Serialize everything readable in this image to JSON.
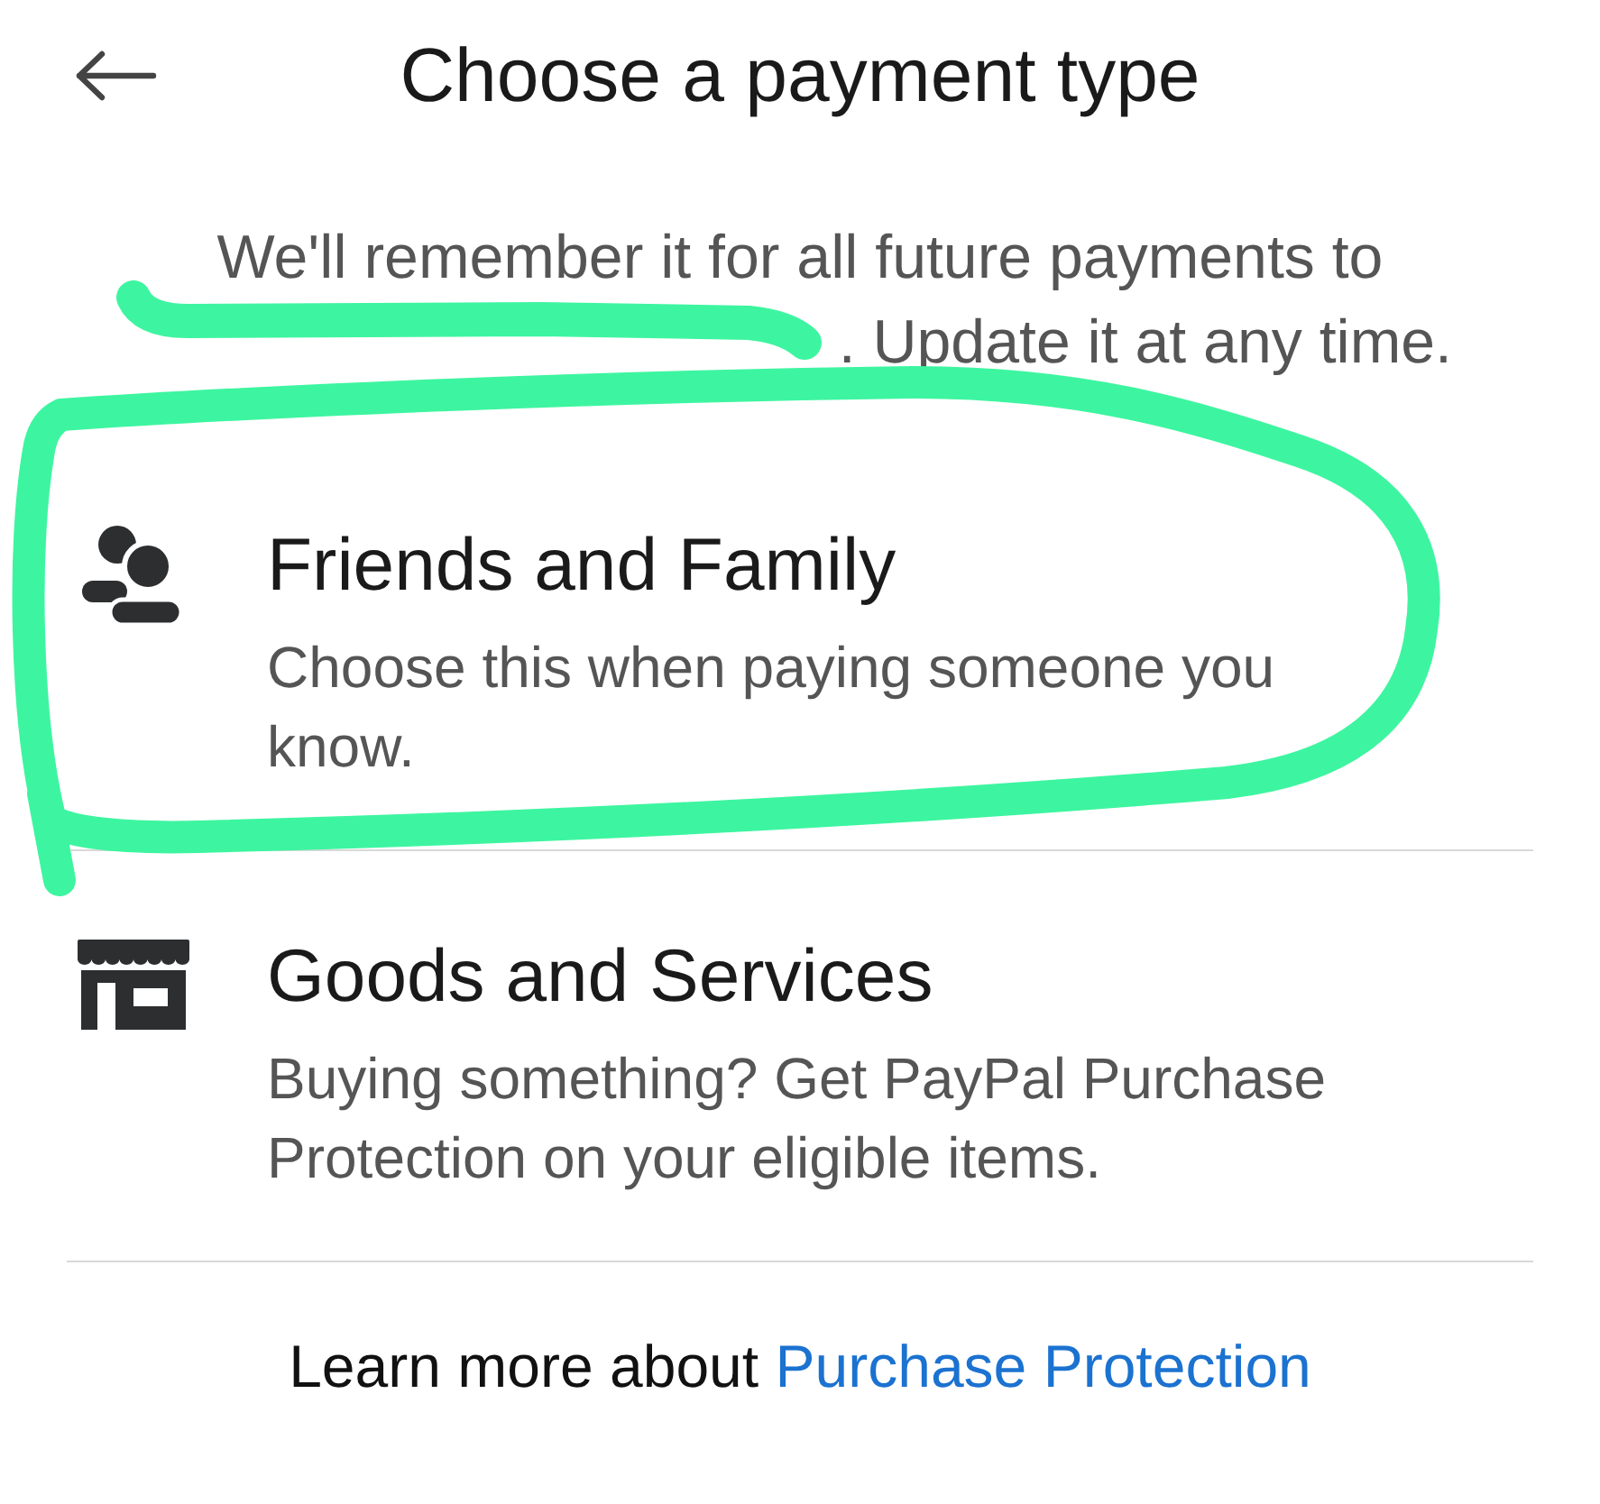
{
  "header": {
    "title": "Choose a payment type"
  },
  "intro": {
    "line_1": "We'll remember it for all future payments to",
    "redacted": true,
    "line_2_end": ". Update it at any time."
  },
  "options": [
    {
      "kind": "friends_family",
      "title": "Friends and Family",
      "description": "Choose this when paying someone you know.",
      "marked": true
    },
    {
      "kind": "goods_services",
      "title": "Goods and Services",
      "description": "Buying something? Get PayPal Purchase Protection on your eligible items.",
      "marked": false
    }
  ],
  "footer": {
    "text": "Learn more about",
    "link": "Purchase Protection"
  }
}
